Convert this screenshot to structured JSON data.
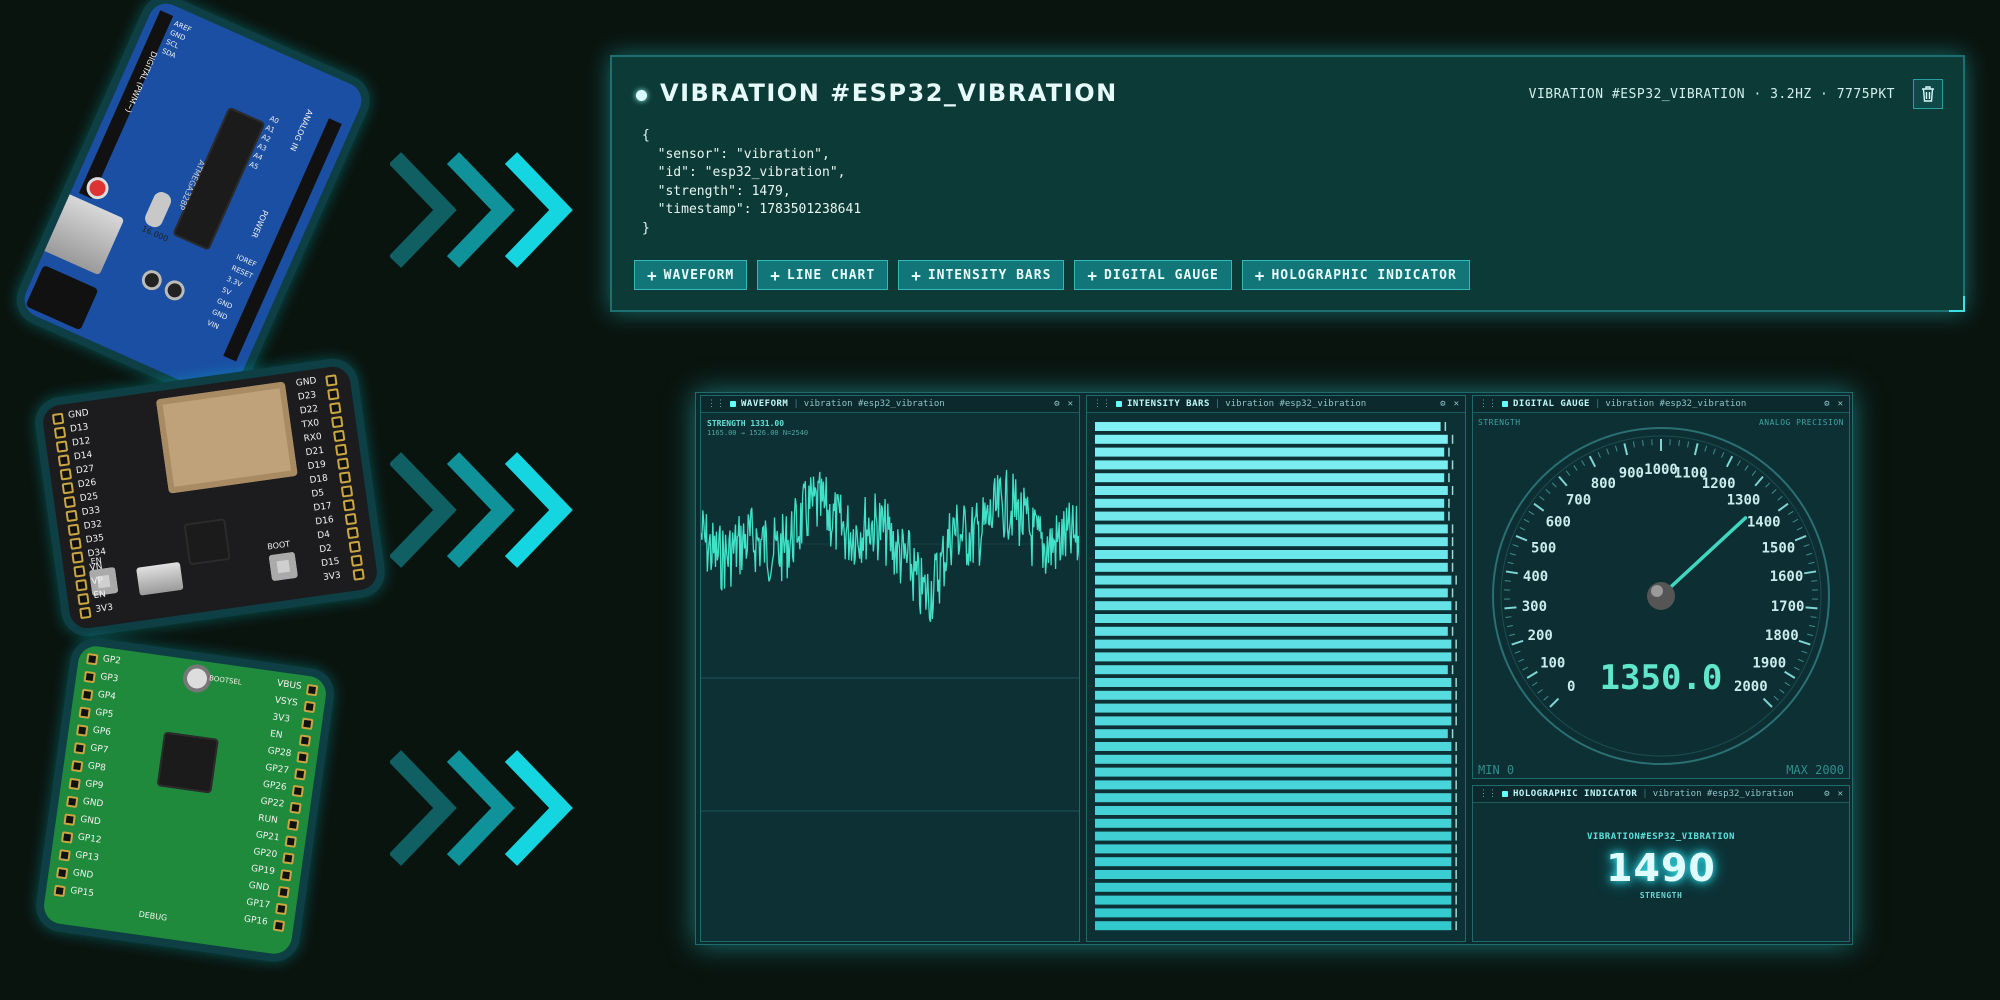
{
  "colors": {
    "accent": "#34d6c8",
    "glow": "#2ad4e0",
    "background": "#0a140f"
  },
  "boards": {
    "uno_labels": [
      "DIGITAL (PWM~)",
      "ANALOG IN",
      "POWER",
      "IOREF",
      "RESET",
      "3.3V",
      "5V",
      "GND",
      "GND",
      "VIN",
      "A0",
      "A1",
      "A2",
      "A3",
      "A4",
      "A5",
      "AREF",
      "GND",
      "SCL",
      "SDA",
      "16.000",
      "ATMEGA328P"
    ],
    "esp32_left_pins": [
      "3V3",
      "EN",
      "VP",
      "VN",
      "D34",
      "D35",
      "D32",
      "D33",
      "D25",
      "D26",
      "D27",
      "D14",
      "D12",
      "D13",
      "GND"
    ],
    "esp32_right_pins": [
      "GND",
      "D23",
      "D22",
      "TX0",
      "RX0",
      "D21",
      "D19",
      "D18",
      "D5",
      "D17",
      "D16",
      "D4",
      "D2",
      "D15",
      "3V3"
    ],
    "esp32_buttons": [
      "EN",
      "BOOT"
    ],
    "pico_left_pins": [
      "GP2",
      "GP3",
      "GP4",
      "GP5",
      "GP6",
      "GP7",
      "GP8",
      "GP9",
      "GND",
      "GND",
      "GP12",
      "GP13",
      "GND",
      "GP15"
    ],
    "pico_right_pins": [
      "VBUS",
      "VSYS",
      "3V3",
      "EN",
      "GP28",
      "GP27",
      "GP26",
      "GP22",
      "RUN",
      "GP21",
      "GP20",
      "GP19",
      "GND",
      "GP17",
      "GP16"
    ],
    "pico_labels": [
      "BOOTSEL",
      "DEBUG"
    ]
  },
  "top_panel": {
    "title": "VIBRATION #ESP32_VIBRATION",
    "meta": "VIBRATION #ESP32_VIBRATION · 3.2HZ · 7775PKT",
    "trash_icon": "trash-icon",
    "json_text": "{\n  \"sensor\": \"vibration\",\n  \"id\": \"esp32_vibration\",\n  \"strength\": 1479,\n  \"timestamp\": 1783501238641\n}",
    "buttons": [
      "WAVEFORM",
      "LINE CHART",
      "INTENSITY BARS",
      "DIGITAL GAUGE",
      "HOLOGRAPHIC INDICATOR"
    ]
  },
  "widgets": {
    "waveform": {
      "title": "WAVEFORM",
      "source": "vibration #esp32_vibration",
      "readout": "STRENGTH 1331.00",
      "range": "1165.00 → 1526.00   N=2540"
    },
    "intensity_bars": {
      "title": "INTENSITY BARS",
      "source": "vibration #esp32_vibration",
      "bar_levels": [
        0.96,
        0.98,
        0.97,
        0.98,
        0.97,
        0.98,
        0.97,
        0.97,
        0.98,
        0.98,
        0.98,
        0.98,
        0.99,
        0.98,
        0.99,
        0.99,
        0.98,
        0.99,
        0.99,
        0.98,
        0.99,
        0.99,
        0.99,
        0.99,
        0.98,
        0.99,
        0.99,
        0.99,
        0.99,
        0.99,
        0.99,
        0.99,
        0.99,
        0.99,
        0.99,
        0.99,
        0.99,
        0.99,
        0.99,
        0.99
      ]
    },
    "digital_gauge": {
      "title": "DIGITAL GAUGE",
      "source": "vibration #esp32_vibration",
      "label_left": "STRENGTH",
      "label_right": "ANALOG PRECISION",
      "ticks": [
        "0",
        "100",
        "200",
        "300",
        "400",
        "500",
        "600",
        "700",
        "800",
        "900",
        "1000",
        "1100",
        "1200",
        "1300",
        "1400",
        "1500",
        "1600",
        "1700",
        "1800",
        "1900",
        "2000"
      ],
      "value": 1350.0,
      "value_text": "1350.0",
      "min_text": "MIN 0",
      "max_text": "MAX 2000",
      "min": 0,
      "max": 2000
    },
    "holographic": {
      "title": "HOLOGRAPHIC INDICATOR",
      "source": "vibration #esp32_vibration",
      "source_label": "VIBRATION#ESP32_VIBRATION",
      "value": "1490",
      "unit": "STRENGTH"
    }
  }
}
